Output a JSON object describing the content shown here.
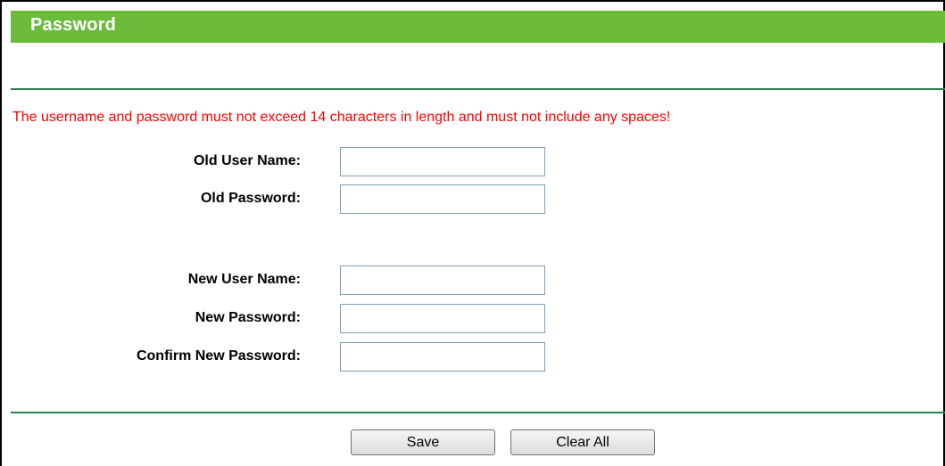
{
  "header": {
    "title": "Password"
  },
  "warning_text": "The username and password must not exceed 14 characters in length and must not include any spaces!",
  "form": {
    "old_user_name": {
      "label": "Old User Name:",
      "value": ""
    },
    "old_password": {
      "label": "Old Password:",
      "value": ""
    },
    "new_user_name": {
      "label": "New User Name:",
      "value": ""
    },
    "new_password": {
      "label": "New Password:",
      "value": ""
    },
    "confirm_new_password": {
      "label": "Confirm New Password:",
      "value": ""
    }
  },
  "buttons": {
    "save_label": "Save",
    "clear_all_label": "Clear All"
  },
  "colors": {
    "title_bar": "#6dbb3b",
    "divider": "#2e7d4f",
    "warning": "#ff0000"
  }
}
